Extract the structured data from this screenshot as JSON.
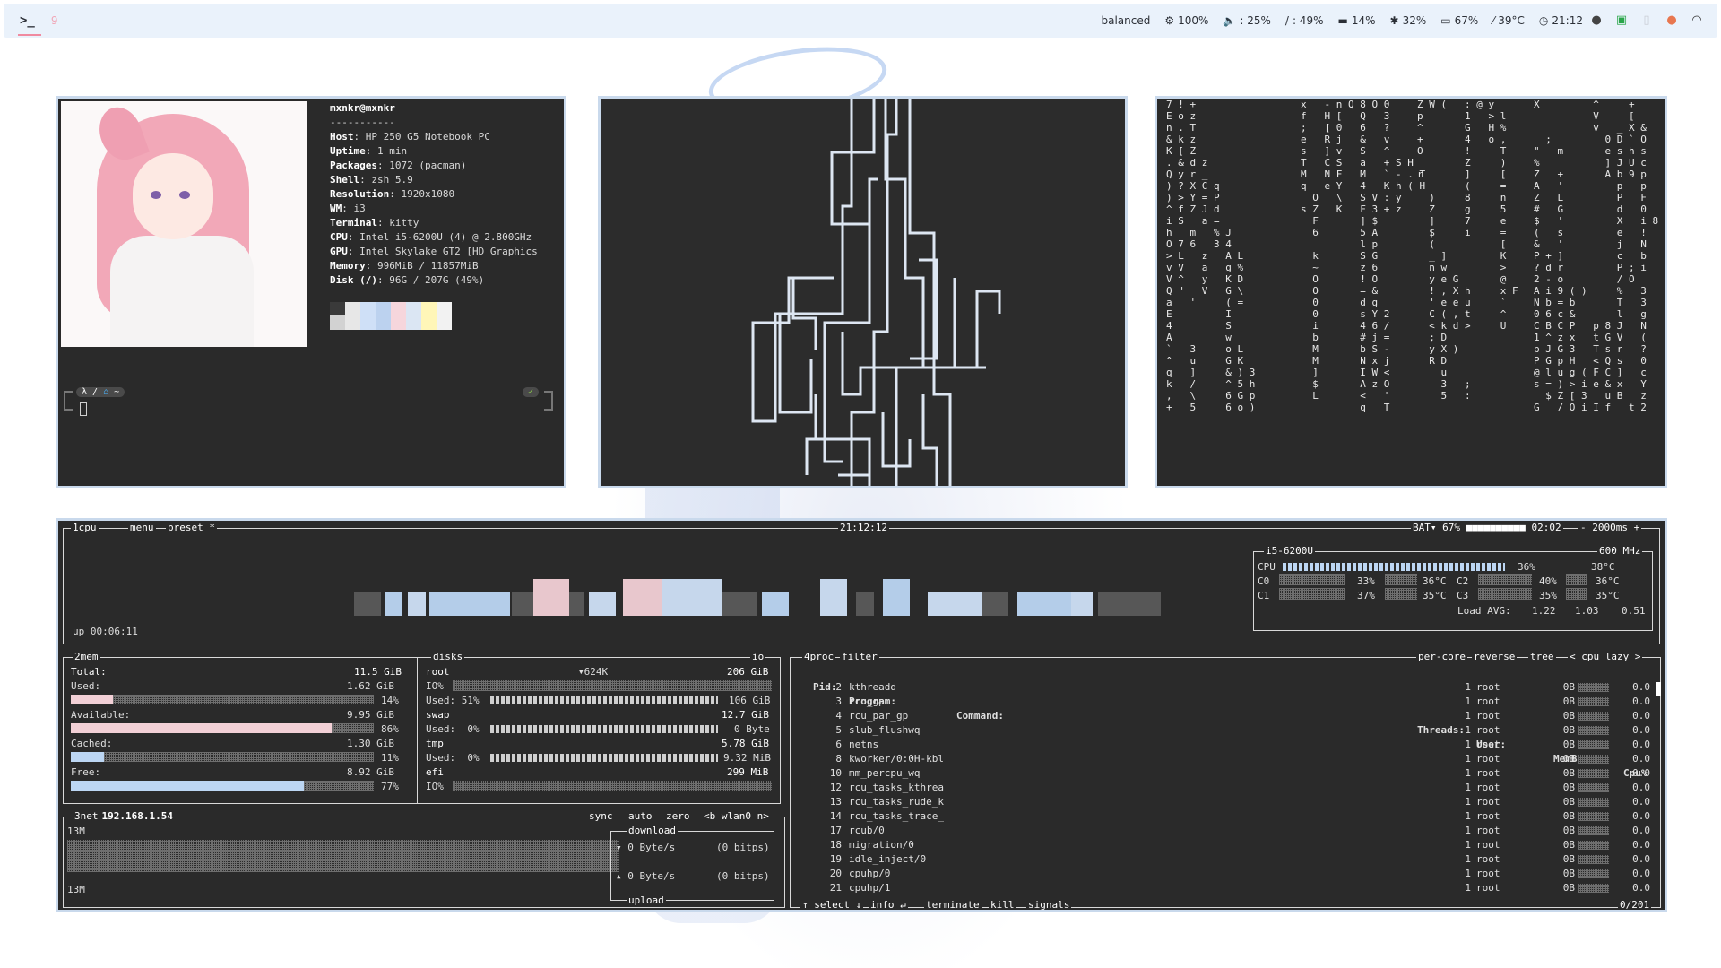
{
  "topbar": {
    "terminal_icon": "terminal-icon",
    "workspace": "9",
    "power_profile": "balanced",
    "brightness": "100%",
    "volume": ": 25%",
    "cpu": ": 49%",
    "memory": "14%",
    "disk": "32%",
    "battery": "67%",
    "temperature": "39°C",
    "clock": "21:12"
  },
  "neofetch": {
    "user": "mxnkr@mxnkr",
    "separator": "-----------",
    "lines": [
      {
        "k": "Host",
        "v": "HP 250 G5 Notebook PC"
      },
      {
        "k": "Uptime",
        "v": "1 min"
      },
      {
        "k": "Packages",
        "v": "1072 (pacman)"
      },
      {
        "k": "Shell",
        "v": "zsh 5.9"
      },
      {
        "k": "Resolution",
        "v": "1920x1080"
      },
      {
        "k": "WM",
        "v": "i3"
      },
      {
        "k": "Terminal",
        "v": "kitty"
      },
      {
        "k": "CPU",
        "v": "Intel i5-6200U (4) @ 2.800GHz"
      },
      {
        "k": "GPU",
        "v": "Intel Skylake GT2 [HD Graphics"
      },
      {
        "k": "Memory",
        "v": "996MiB / 11857MiB"
      },
      {
        "k": "Disk (/)",
        "v": "96G / 207G (49%)"
      }
    ],
    "swatches_row1": [
      "#3a3a3a",
      "#e7e7e7",
      "#cfe0f7",
      "#bcd2ef",
      "#f6d6dc",
      "#dbe6f3",
      "#fff6b8",
      "#f2f2f2"
    ],
    "swatches_row2": [
      "#d2d2d2",
      "#e7e7e7",
      "#cfe0f7",
      "#bcd2ef",
      "#f6d6dc",
      "#dbe6f3",
      "#fff6b8",
      "#f2f2f2"
    ],
    "prompt_left": "λ",
    "prompt_dir": "~",
    "prompt_right": "✓"
  },
  "matrix": {
    "columns": [
      "7 ! +\nE o z\nn . T\n& k z\nK [ Z\n. & d z\nQ y r _\n) ? X C q\n) > Y = P\n^ f Z J d\ni S   a =\nh   m   % J\nO 7 6   3 4\n> L   z   A L\nv V   a   g %\nV ^   y   K D\nQ \"   V   G \\\na   '     ( =\nE         I\n4         S\nA         w\n`   3     o L\n^   u     G K\nq   ]     & ) 3\nk   /     ^ 5 h\n,   \\     6 G p\n+   5     6 o )",
      "x   - n Q 8 O 0\nf   H [   Q   3\n;   [ 0   6   ?\ne   R j   &   v\ns   ] v   S   ^\nT   C S   a   + S H\nM   N F   M   ` - . T\nq   e Y   4   K h ( H\n_ O   \\   S V : y\ns Z   K   F 3 + z\n  F       ] $\n  6       5 A\n          l p\n  k       S G\n  ~       z 6\n  O       ! O\n  O       = &\n  0       d g\n  0       s Y 2\n  i       4 6 /\n  b       # j =\n  M       b S -\n  M       N x j\n  ]       I W <\n  $       A z O\n  L       <   '\n          q   T",
      "Z W (   : @ y\np       1   > l\n^       G   H %\n+       4   o ,\nO       !     T\n        Z     )\nr       ]     [\n        (     =\n  )     8     n\n  Z     g     5\n  ]     7     e\n  $     i     =\n  (           [\n  _ ]         K\n  n w         >\n  y e G       @\n  ! , X h     x F\n  ' e e u     `\n  C ( , t     ^\n  < k d >     U\n  ; D          \n  y X )        \n  R D          \n    u          \n    3   ;      \n    5   :      ",
      "X         ^     +\n          V     [\n          v   _ X &\n  ;         0 D ` O\n\"   m       e s h s\n%           ] J U c\nZ   +       A b 9 p\nA   '         p   p\nZ   L         P   F\n#   G         d   0\n$   '         X   i 8\n(   s         e   !\n&   '         j   N\nP + ]         c   b\n? d r         P ; i\n2 - o         / O\nA i 9 ( )     %   3\nN b = b       T   3\n0 6 c &       l   g\nC B C P   p 8 J   N\n1 ^ z x   t G V   (\np J G 3   T s r   ?\nP G p H   < Q s   0\n@ l u g ( F C ]   c\ns = ) > i e & x   Y\n  $ Z [ 3   u B   z\nG   / O i I f   t 2"
    ]
  },
  "btop": {
    "cpu_box_label": "1cpu",
    "menu_label": "menu",
    "preset_label": "preset *",
    "clock": "21:12:12",
    "battery": "BAT▾ 67%",
    "battery_time": "02:02",
    "interval": "- 2000ms +",
    "uptime": "up 00:06:11",
    "cpu_model": "i5-6200U",
    "cpu_freq": "600 MHz",
    "cpu_rows": [
      {
        "name": "CPU",
        "pct": "36%",
        "temp": "38°C",
        "fill": 0.36
      },
      {
        "name": "C0",
        "pct": "33%",
        "temp": "36°C"
      },
      {
        "name": "C1",
        "pct": "37%",
        "temp": "35°C"
      },
      {
        "name": "C2",
        "pct": "40%",
        "temp": "36°C"
      },
      {
        "name": "C3",
        "pct": "35%",
        "temp": "35°C"
      }
    ],
    "load_avg_label": "Load AVG:",
    "load_avg": [
      "1.22",
      "1.03",
      "0.51"
    ],
    "mem": {
      "label": "2mem",
      "total_label": "Total:",
      "total": "11.5 GiB",
      "used_label": "Used:",
      "used": "1.62 GiB",
      "used_pct": "14%",
      "used_fill": 0.14,
      "avail_label": "Available:",
      "avail": "9.95 GiB",
      "avail_pct": "86%",
      "avail_fill": 0.86,
      "cached_label": "Cached:",
      "cached": "1.30 GiB",
      "cached_pct": "11%",
      "cached_fill": 0.11,
      "free_label": "Free:",
      "free": "8.92 GiB",
      "free_pct": "77%",
      "free_fill": 0.77
    },
    "disks": {
      "label": "disks",
      "io_label": "io",
      "root_name": "root",
      "root_io_rate": "▾624K",
      "root_size": "206 GiB",
      "root_io": "IO%",
      "root_used": "Used: 51%",
      "root_used_val": "106 GiB",
      "root_fill": 0.51,
      "swap_name": "swap",
      "swap_size": "12.7 GiB",
      "swap_used": "Used:  0%",
      "swap_used_val": "0 Byte",
      "tmp_name": "tmp",
      "tmp_size": "5.78 GiB",
      "tmp_used": "Used:  0%",
      "tmp_used_val": "9.32 MiB",
      "efi_name": "efi",
      "efi_size": "299 MiB",
      "efi_io": "IO%"
    },
    "net": {
      "label": "3net",
      "ip": "192.168.1.54",
      "sync": "sync",
      "auto": "auto",
      "zero": "zero",
      "iface": "<b wlan0 n>",
      "scale_top": "13M",
      "scale_bottom": "13M",
      "download": "download",
      "upload": "upload",
      "down_rate": "▾ 0 Byte/s",
      "down_bits": "(0 bitps)",
      "up_rate": "▴ 0 Byte/s",
      "up_bits": "(0 bitps)"
    },
    "proc": {
      "label": "4proc",
      "filter": "filter",
      "per_core": "per-core",
      "reverse": "reverse",
      "tree": "tree",
      "sort": "< cpu lazy >",
      "headers": {
        "pid": "Pid:",
        "program": "Program:",
        "command": "Command:",
        "threads": "Threads:",
        "user": "User:",
        "mem": "MemB",
        "cpu": "Cpu%"
      },
      "rows": [
        {
          "pid": "2",
          "program": "kthreadd",
          "threads": "1",
          "user": "root",
          "mem": "0B",
          "cpu": "0.0"
        },
        {
          "pid": "3",
          "program": "rcu_gp",
          "threads": "1",
          "user": "root",
          "mem": "0B",
          "cpu": "0.0"
        },
        {
          "pid": "4",
          "program": "rcu_par_gp",
          "threads": "1",
          "user": "root",
          "mem": "0B",
          "cpu": "0.0"
        },
        {
          "pid": "5",
          "program": "slub_flushwq",
          "threads": "1",
          "user": "root",
          "mem": "0B",
          "cpu": "0.0"
        },
        {
          "pid": "6",
          "program": "netns",
          "threads": "1",
          "user": "root",
          "mem": "0B",
          "cpu": "0.0"
        },
        {
          "pid": "8",
          "program": "kworker/0:0H-kbl",
          "threads": "1",
          "user": "root",
          "mem": "0B",
          "cpu": "0.0"
        },
        {
          "pid": "10",
          "program": "mm_percpu_wq",
          "threads": "1",
          "user": "root",
          "mem": "0B",
          "cpu": "0.0"
        },
        {
          "pid": "12",
          "program": "rcu_tasks_kthrea",
          "threads": "1",
          "user": "root",
          "mem": "0B",
          "cpu": "0.0"
        },
        {
          "pid": "13",
          "program": "rcu_tasks_rude_k",
          "threads": "1",
          "user": "root",
          "mem": "0B",
          "cpu": "0.0"
        },
        {
          "pid": "14",
          "program": "rcu_tasks_trace_",
          "threads": "1",
          "user": "root",
          "mem": "0B",
          "cpu": "0.0"
        },
        {
          "pid": "17",
          "program": "rcub/0",
          "threads": "1",
          "user": "root",
          "mem": "0B",
          "cpu": "0.0"
        },
        {
          "pid": "18",
          "program": "migration/0",
          "threads": "1",
          "user": "root",
          "mem": "0B",
          "cpu": "0.0"
        },
        {
          "pid": "19",
          "program": "idle_inject/0",
          "threads": "1",
          "user": "root",
          "mem": "0B",
          "cpu": "0.0"
        },
        {
          "pid": "20",
          "program": "cpuhp/0",
          "threads": "1",
          "user": "root",
          "mem": "0B",
          "cpu": "0.0"
        },
        {
          "pid": "21",
          "program": "cpuhp/1",
          "threads": "1",
          "user": "root",
          "mem": "0B",
          "cpu": "0.0"
        }
      ],
      "footer_select": "↑ select ↓",
      "footer_info": "info ↵",
      "footer_terminate": "terminate",
      "footer_kill": "kill",
      "footer_signals": "signals",
      "count": "0/201"
    }
  },
  "colors": {
    "accent_pink": "#f2d0d6",
    "accent_blue": "#bcd6f3",
    "bar_border": "#c9d9ec",
    "terminal_bg": "#2a2a2a"
  }
}
